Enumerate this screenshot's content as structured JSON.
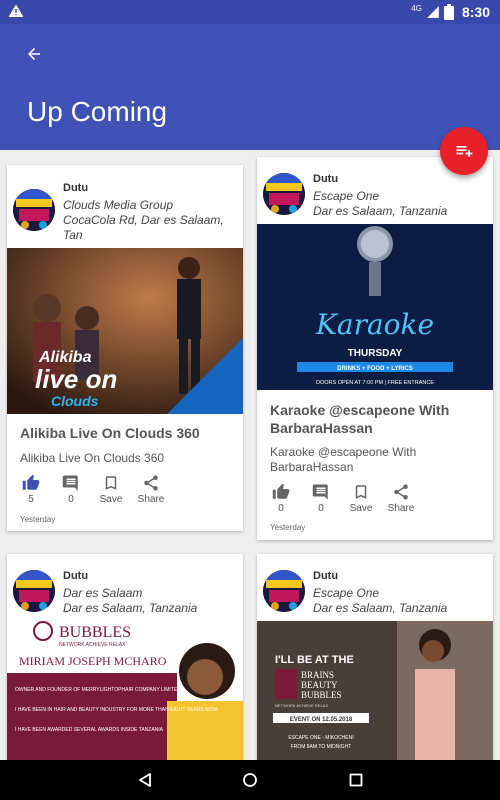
{
  "status_bar": {
    "network": "4G",
    "time": "8:30"
  },
  "header": {
    "title": "Up Coming"
  },
  "cards": [
    {
      "user": "Dutu",
      "venue": "Clouds Media Group",
      "address": "CocaCola Rd, Dar es Salaam, Tan",
      "image_text": {
        "line1": "Alikiba",
        "line2": "live on",
        "line3": "Clouds"
      },
      "title": "Alikiba Live On Clouds 360",
      "description": "Alikiba Live On Clouds 360",
      "likes": "5",
      "comments": "0",
      "save_label": "Save",
      "share_label": "Share",
      "posted": "Yesterday"
    },
    {
      "user": "Dutu",
      "venue": "Escape One",
      "address": "Dar es Salaam, Tanzania",
      "image_text": {
        "heading": "Karaoke",
        "subheading": "THURSDAY",
        "tags": "DRINKS + FOOD + LYRICS",
        "footer": "DOORS OPEN AT 7:00 PM | FREE ENTRANCE"
      },
      "title": "Karaoke @escapeone With BarbaraHassan",
      "description": "Karaoke @escapeone With BarbaraHassan",
      "likes": "0",
      "comments": "0",
      "save_label": "Save",
      "share_label": "Share",
      "posted": "Yesterday"
    },
    {
      "user": "Dutu",
      "venue": "Dar es Salaam",
      "address": "Dar es Salaam, Tanzania",
      "image_text": {
        "brand": "BUBBLES",
        "brand_sub": "NETWORK ACHIEVE RELAX",
        "name": "MIRIAM JOSEPH MCHARO",
        "bio1": "OWNER AND FOUNDER OF MERRYLIGHTOPHAIR COMPANY LIMITED.",
        "bio2": "I HAVE BEEN IN HAIR AND BEAUTY INDUSTRY FOR MORE THAN EIGHT YEARS NOW.",
        "bio3": "I HAVE BEEN AWARDED SEVERAL AWARDS INSIDE TANZANIA"
      }
    },
    {
      "user": "Dutu",
      "venue": "Escape One",
      "address": "Dar es Salaam, Tanzania",
      "image_text": {
        "line1": "I'LL BE AT THE",
        "brand1": "BRAINS",
        "brand2": "BEAUTY",
        "brand3": "BUBBLES",
        "brand_sub": "NETWORK ACHIEVE RELAX",
        "event_date": "EVENT ON 12.05.2018",
        "place": "ESCAPE ONE - MIKOCHENI",
        "hours": "FROM 8AM TO MIDNIGHT"
      }
    }
  ],
  "colors": {
    "primary": "#3f51b5",
    "status_bar": "#3949ab",
    "fab": "#e8202a",
    "like_active": "#3f51b5"
  },
  "icons": {
    "back": "arrow-back-icon",
    "fab": "playlist-add-icon",
    "like": "thumb-up-icon",
    "comment": "comment-icon",
    "save": "bookmark-icon",
    "share": "share-icon"
  }
}
